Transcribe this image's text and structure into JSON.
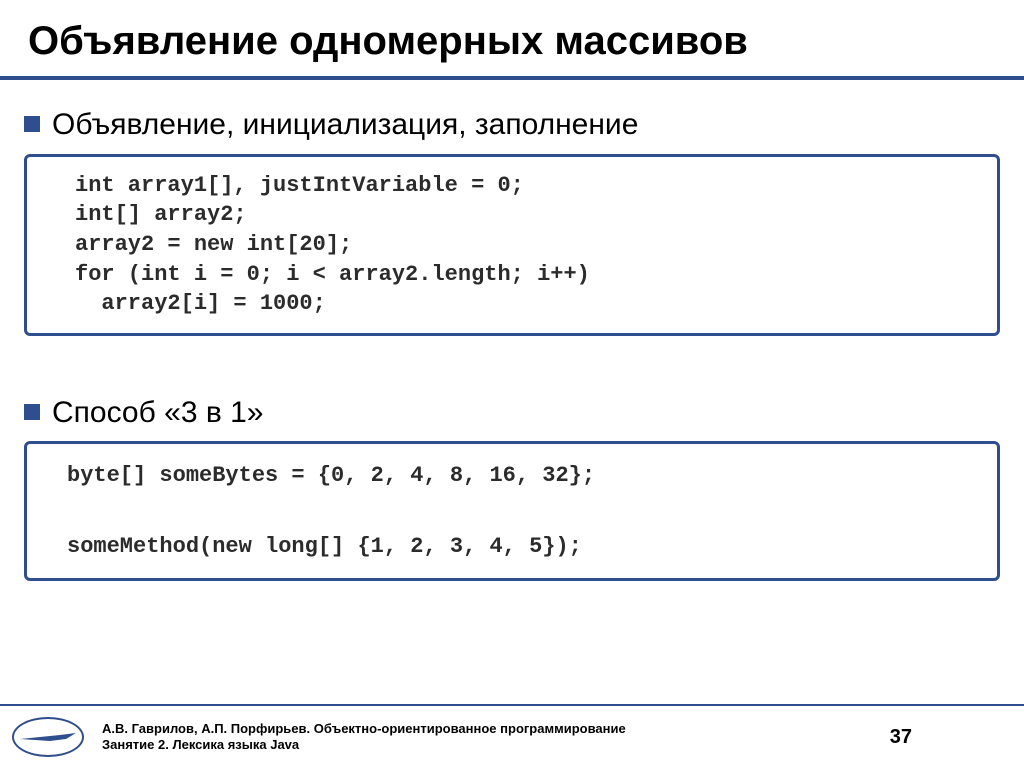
{
  "title": "Объявление одномерных массивов",
  "bullets": {
    "b1": "Объявление, инициализация, заполнение",
    "b2": "Способ «3 в 1»"
  },
  "code1": "int array1[], justIntVariable = 0;\nint[] array2;\narray2 = new int[20];\nfor (int i = 0; i < array2.length; i++)\n  array2[i] = 1000;",
  "code2": "byte[] someBytes = {0, 2, 4, 8, 16, 32};\n\nsomeMethod(new long[] {1, 2, 3, 4, 5});",
  "footer": {
    "line1": "А.В. Гаврилов, А.П. Порфирьев. Объектно-ориентированное программирование",
    "line2": "Занятие 2. Лексика языка Java"
  },
  "page_number": "37"
}
